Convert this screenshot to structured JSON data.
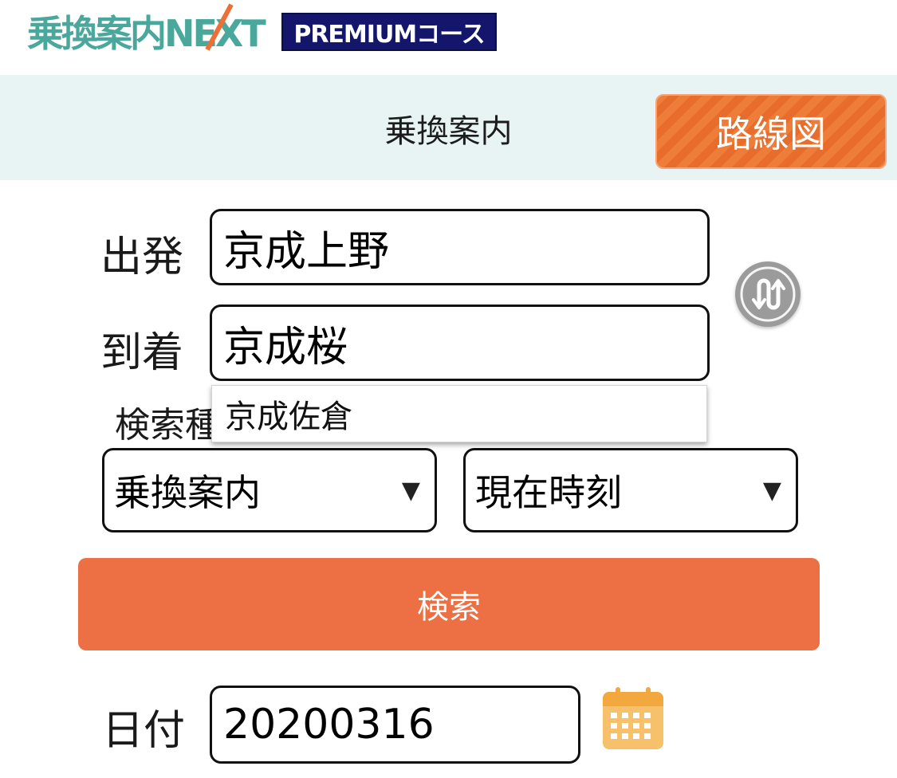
{
  "header": {
    "logo_text": "乗換案内NEXT",
    "premium_badge": "PREMIUMコース"
  },
  "titlebar": {
    "title": "乗換案内",
    "route_map_label": "路線図"
  },
  "form": {
    "departure_label": "出発",
    "departure_value": "京成上野",
    "arrival_label": "到着",
    "arrival_value": "京成桜",
    "search_type_label": "検索種",
    "suggestion": "京成佐倉",
    "search_type_value": "乗換案内",
    "time_value": "現在時刻",
    "search_button": "検索",
    "date_label": "日付",
    "date_value": "20200316"
  },
  "icons": {
    "swap": "swap-icon",
    "calendar": "calendar-icon"
  },
  "colors": {
    "accent": "#ec7044",
    "logo": "#4aa79c",
    "premium_bg": "#14166b",
    "titlebar_bg": "#e8f3f3",
    "calendar": "#f4b24a"
  }
}
